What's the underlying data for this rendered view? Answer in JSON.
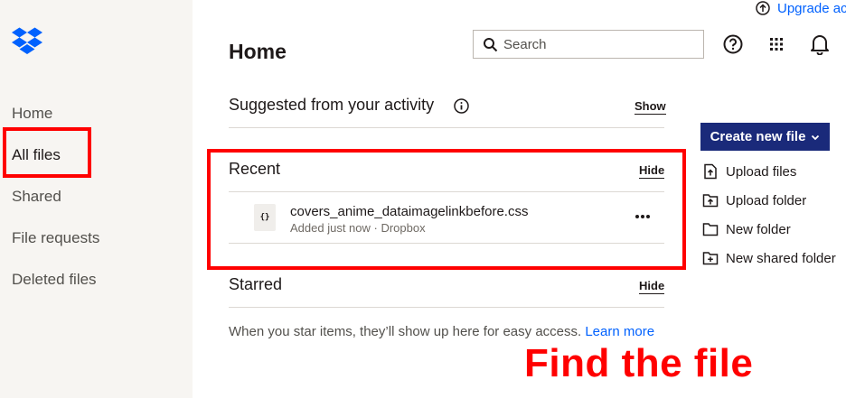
{
  "header": {
    "upgrade_label": "Upgrade ac",
    "page_title": "Home",
    "search_placeholder": "Search"
  },
  "sidebar": {
    "items": [
      {
        "label": "Home"
      },
      {
        "label": "All files"
      },
      {
        "label": "Shared"
      },
      {
        "label": "File requests"
      },
      {
        "label": "Deleted files"
      }
    ]
  },
  "sections": {
    "suggested": {
      "title": "Suggested from your activity",
      "action": "Show"
    },
    "recent": {
      "title": "Recent",
      "action": "Hide"
    },
    "starred": {
      "title": "Starred",
      "action": "Hide"
    }
  },
  "recent_files": [
    {
      "name": "covers_anime_dataimagelinkbefore.css",
      "meta": "Added just now · Dropbox",
      "icon_text": "{}"
    }
  ],
  "starred_empty": {
    "text": "When you star items, they’ll show up here for easy access.",
    "link": "Learn more"
  },
  "actions": {
    "create_label": "Create new file",
    "items": [
      {
        "label": "Upload files"
      },
      {
        "label": "Upload folder"
      },
      {
        "label": "New folder"
      },
      {
        "label": "New shared folder"
      }
    ]
  },
  "annotation": {
    "text": "Find the file"
  },
  "colors": {
    "brand": "#0061fe",
    "create_button": "#1a2a7a",
    "annotation": "#ff0000",
    "sidebar_bg": "#f7f5f2"
  }
}
